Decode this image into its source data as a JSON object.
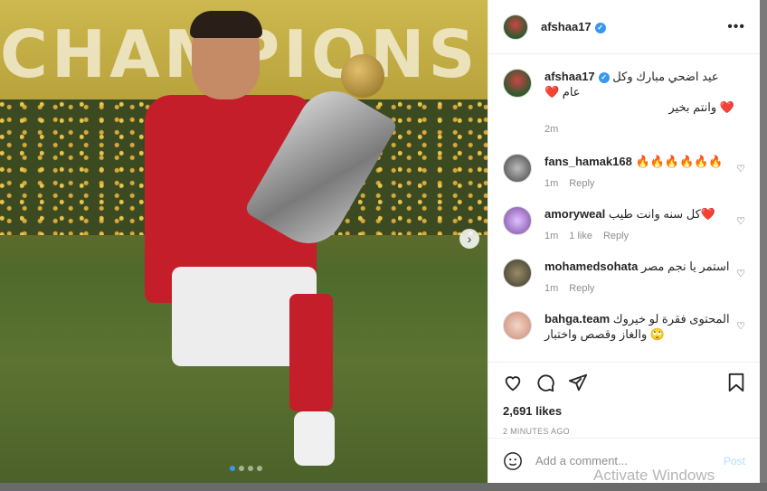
{
  "media": {
    "banner_text": "CHAMPIONS",
    "next_icon": "chevron-right-icon",
    "carousel_dots": 4,
    "active_dot": 0
  },
  "header": {
    "username": "afshaa17",
    "more_icon": "more-horizontal-icon"
  },
  "caption": {
    "username": "afshaa17",
    "text_line1": "عيد اضحي مبارك وكل عام ❤️",
    "text_line2": "❤️ وانتم بخير",
    "time": "2m"
  },
  "comments": [
    {
      "username": "fans_hamak168",
      "text": "🔥🔥🔥🔥🔥🔥",
      "time": "1m",
      "likes": "",
      "reply": "Reply"
    },
    {
      "username": "amoryweal",
      "text": "❤️كل سنه وانت طيب",
      "time": "1m",
      "likes": "1 like",
      "reply": "Reply"
    },
    {
      "username": "mohamedsohata",
      "text": "استمر يا نجم مصر",
      "time": "1m",
      "likes": "",
      "reply": "Reply"
    },
    {
      "username": "bahga.team",
      "text": "المحتوى فقرة لو خيروك 🙄 والغاز وقصص واختبار",
      "time": "",
      "likes": "",
      "reply": ""
    }
  ],
  "actions": {
    "likes": "2,691 likes",
    "time_ago": "2 MINUTES AGO"
  },
  "add_comment": {
    "placeholder": "Add a comment...",
    "post_label": "Post"
  },
  "watermark": "Activate Windows",
  "colors": {
    "accent": "#3897f0",
    "post_disabled": "#b2dffc",
    "jersey_red": "#c41e2a"
  }
}
